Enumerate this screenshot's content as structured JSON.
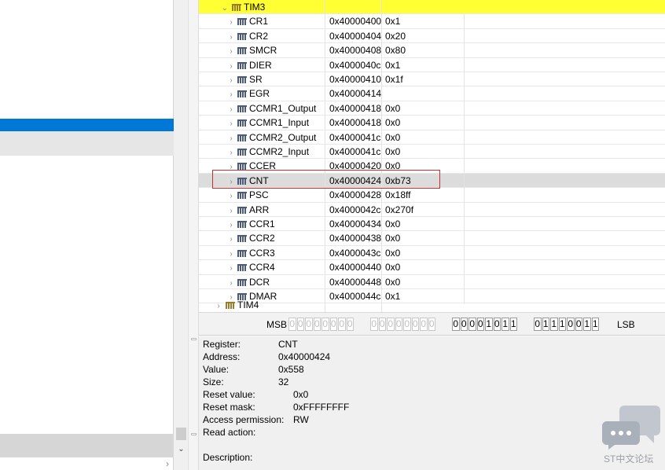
{
  "peripheral_header": "TIM3",
  "next_peripheral": "TIM4",
  "registers": [
    {
      "name": "CR1",
      "address": "0x40000400",
      "value": "0x1"
    },
    {
      "name": "CR2",
      "address": "0x40000404",
      "value": "0x20"
    },
    {
      "name": "SMCR",
      "address": "0x40000408",
      "value": "0x80"
    },
    {
      "name": "DIER",
      "address": "0x4000040c",
      "value": "0x1"
    },
    {
      "name": "SR",
      "address": "0x40000410",
      "value": "0x1f"
    },
    {
      "name": "EGR",
      "address": "0x40000414",
      "value": ""
    },
    {
      "name": "CCMR1_Output",
      "address": "0x40000418",
      "value": "0x0"
    },
    {
      "name": "CCMR1_Input",
      "address": "0x40000418",
      "value": "0x0"
    },
    {
      "name": "CCMR2_Output",
      "address": "0x4000041c",
      "value": "0x0"
    },
    {
      "name": "CCMR2_Input",
      "address": "0x4000041c",
      "value": "0x0"
    },
    {
      "name": "CCER",
      "address": "0x40000420",
      "value": "0x0"
    },
    {
      "name": "CNT",
      "address": "0x40000424",
      "value": "0xb73"
    },
    {
      "name": "PSC",
      "address": "0x40000428",
      "value": "0x18ff"
    },
    {
      "name": "ARR",
      "address": "0x4000042c",
      "value": "0x270f"
    },
    {
      "name": "CCR1",
      "address": "0x40000434",
      "value": "0x0"
    },
    {
      "name": "CCR2",
      "address": "0x40000438",
      "value": "0x0"
    },
    {
      "name": "CCR3",
      "address": "0x4000043c",
      "value": "0x0"
    },
    {
      "name": "CCR4",
      "address": "0x40000440",
      "value": "0x0"
    },
    {
      "name": "DCR",
      "address": "0x40000448",
      "value": "0x0"
    },
    {
      "name": "DMAR",
      "address": "0x4000044c",
      "value": "0x1"
    }
  ],
  "selected_register_index": 11,
  "bitbar": {
    "msb_label": "MSB",
    "lsb_label": "LSB",
    "bits": [
      "0",
      "0",
      "0",
      "0",
      "0",
      "0",
      "0",
      "0",
      "0",
      "0",
      "0",
      "0",
      "0",
      "0",
      "0",
      "0",
      "0",
      "0",
      "0",
      "0",
      "1",
      "0",
      "1",
      "1",
      "0",
      "1",
      "1",
      "1",
      "0",
      "0",
      "1",
      "1"
    ],
    "active_from": 16
  },
  "details": {
    "register_label": "Register:",
    "register_value": "CNT",
    "address_label": "Address:",
    "address_value": "0x40000424",
    "value_label": "Value:",
    "value_value": "0x558",
    "size_label": "Size:",
    "size_value": "32",
    "reset_value_label": "Reset value:",
    "reset_value_value": "0x0",
    "reset_mask_label": "Reset mask:",
    "reset_mask_value": "0xFFFFFFFF",
    "access_label": "Access permission:",
    "access_value": "RW",
    "read_action_label": "Read action:",
    "description_label": "Description:"
  },
  "watermark": "ST中文论坛",
  "icons": {
    "chevron_right": "›",
    "chevron_down": "⌄",
    "scroll_down": "⌄",
    "left_scroll_right": "›"
  },
  "colors": {
    "header": "#ffff33",
    "selection_blue": "#0078d7",
    "selected_row": "#dcdcdc",
    "highlight_box": "#c9302c"
  }
}
